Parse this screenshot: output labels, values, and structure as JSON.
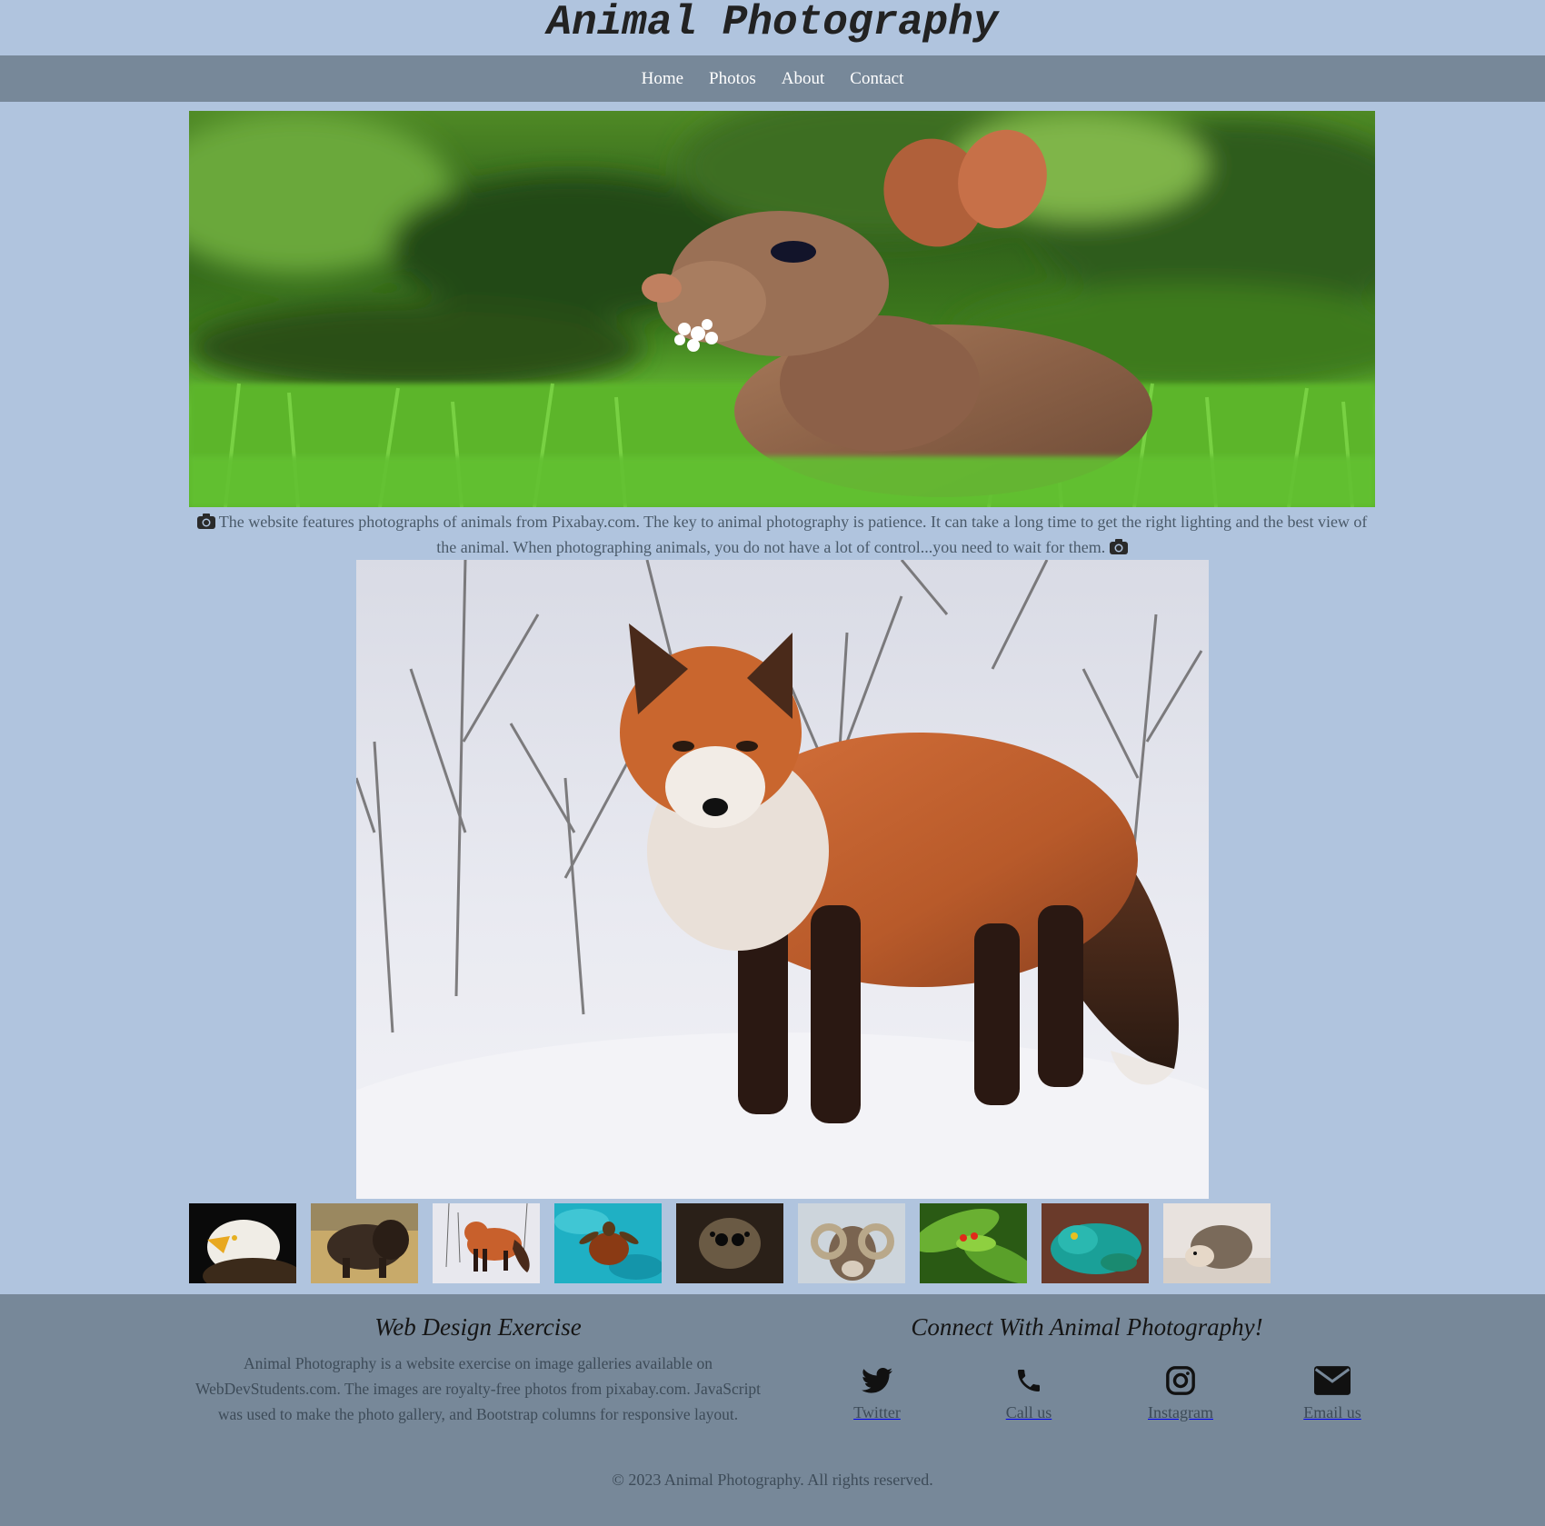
{
  "header": {
    "title": "Animal Photography"
  },
  "nav": {
    "items": [
      {
        "label": "Home"
      },
      {
        "label": "Photos"
      },
      {
        "label": "About"
      },
      {
        "label": "Contact"
      }
    ]
  },
  "intro": {
    "text": "The website features photographs of animals from Pixabay.com. The key to animal photography is patience. It can take a long time to get the right lighting and the best view of the animal. When photographing animals, you do not have a lot of control...you need to wait for them."
  },
  "gallery": {
    "thumbnails": [
      {
        "subject": "bald-eagle"
      },
      {
        "subject": "bison"
      },
      {
        "subject": "red-fox"
      },
      {
        "subject": "sea-turtle"
      },
      {
        "subject": "jumping-spider"
      },
      {
        "subject": "bighorn-ram"
      },
      {
        "subject": "tree-frog"
      },
      {
        "subject": "green-lizard"
      },
      {
        "subject": "hedgehog"
      }
    ]
  },
  "footer": {
    "left_heading": "Web Design Exercise",
    "left_text": "Animal Photography is a website exercise on image galleries available on WebDevStudents.com. The images are royalty-free photos from pixabay.com. JavaScript was used to make the photo gallery, and Bootstrap columns for responsive layout.",
    "right_heading": "Connect With Animal Photography!",
    "social": [
      {
        "label": "Twitter",
        "icon": "twitter-icon"
      },
      {
        "label": "Call us",
        "icon": "phone-icon"
      },
      {
        "label": "Instagram",
        "icon": "instagram-icon"
      },
      {
        "label": "Email us",
        "icon": "envelope-icon"
      }
    ],
    "copyright": "© 2023 Animal Photography. All rights reserved."
  },
  "colors": {
    "page_background": "#b0c4de",
    "nav_background": "#778899",
    "footer_background": "#778899"
  }
}
